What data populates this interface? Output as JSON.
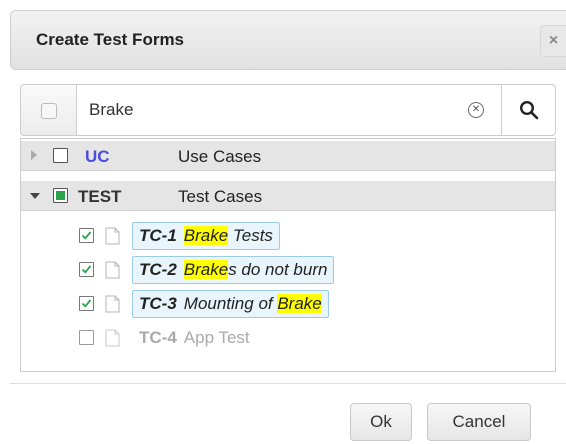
{
  "dialog": {
    "title": "Create Test Forms",
    "close_glyph": "×"
  },
  "search": {
    "value": "Brake",
    "clear_glyph": "✕"
  },
  "tree": {
    "groups": [
      {
        "code": "UC",
        "label": "Use Cases",
        "code_color": "#4b4bdf"
      },
      {
        "code": "TEST",
        "label": "Test Cases",
        "code_color": "#333333"
      }
    ],
    "items": [
      {
        "code": "TC-1",
        "pre": "",
        "hl": "Brake",
        "post": " Tests",
        "checked": true
      },
      {
        "code": "TC-2",
        "pre": "",
        "hl": "Brake",
        "post": "s do not burn",
        "checked": true
      },
      {
        "code": "TC-3",
        "pre": "Mounting of ",
        "hl": "Brake",
        "post": "",
        "checked": true
      },
      {
        "code": "TC-4",
        "text": "App Test",
        "checked": false
      }
    ]
  },
  "buttons": {
    "ok": "Ok",
    "cancel": "Cancel"
  },
  "colors": {
    "accent": "#2aa34a",
    "highlight": "#ffff00",
    "chip_border": "#9ccbe6"
  }
}
